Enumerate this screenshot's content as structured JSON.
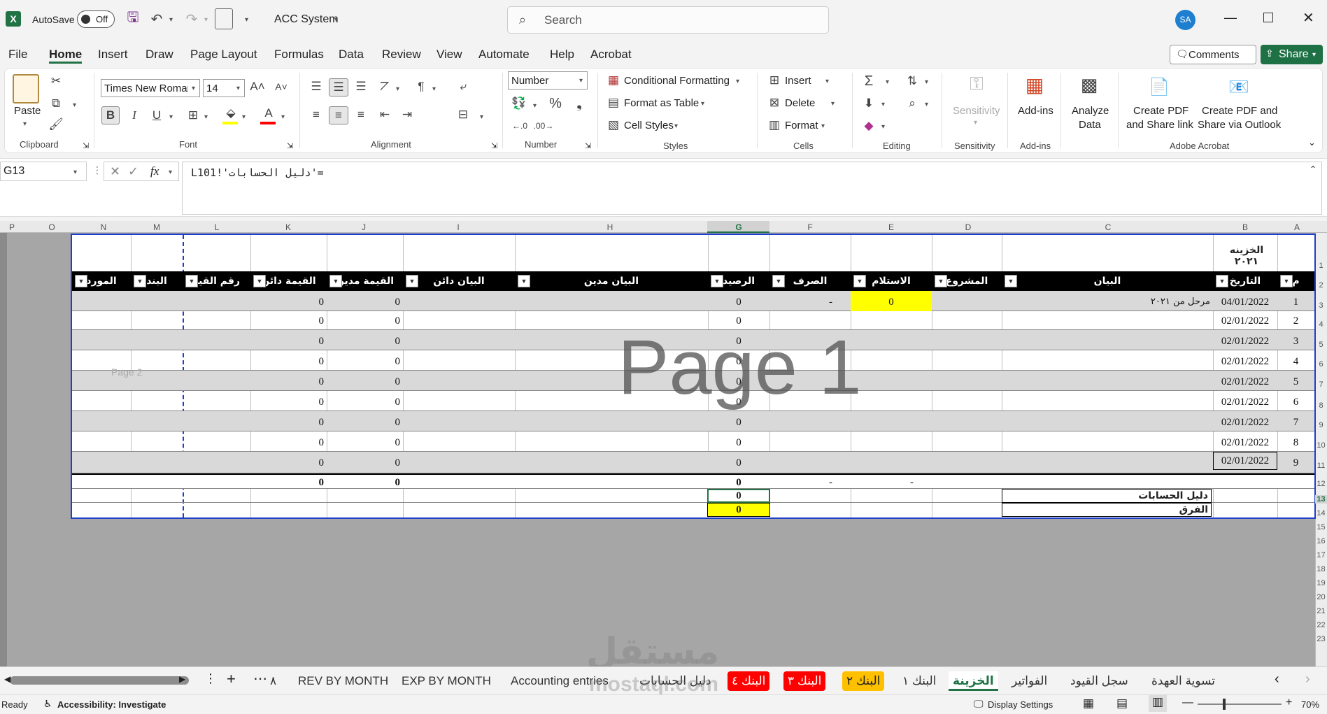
{
  "app": {
    "autosave_label": "AutoSave",
    "autosave_state": "Off",
    "file_name": "ACC System",
    "search_placeholder": "Search",
    "user_initials": "SA"
  },
  "colors": {
    "excel_green": "#217346",
    "header_black": "#000000",
    "highlight_yellow": "#ffff00",
    "tab_red": "#ff0000",
    "tab_orange": "#ffc000",
    "selection_blue": "#1f3ec9"
  },
  "menu": [
    "File",
    "Home",
    "Insert",
    "Draw",
    "Page Layout",
    "Formulas",
    "Data",
    "Review",
    "View",
    "Automate",
    "Help",
    "Acrobat"
  ],
  "menu_active": "Home",
  "top_buttons": {
    "comments": "Comments",
    "share": "Share"
  },
  "ribbon": {
    "clipboard": {
      "paste": "Paste",
      "label": "Clipboard"
    },
    "font": {
      "name": "Times New Roman",
      "size": "14",
      "label": "Font"
    },
    "alignment": {
      "label": "Alignment"
    },
    "number": {
      "format": "Number",
      "label": "Number"
    },
    "styles": {
      "conditional": "Conditional Formatting",
      "format_table": "Format as Table",
      "cell_styles": "Cell Styles",
      "label": "Styles"
    },
    "cells": {
      "insert": "Insert",
      "delete": "Delete",
      "format": "Format",
      "label": "Cells"
    },
    "editing": {
      "label": "Editing"
    },
    "sensitivity": {
      "btn": "Sensitivity",
      "label": "Sensitivity"
    },
    "addins": {
      "btn": "Add-ins",
      "label": "Add-ins"
    },
    "analyze": {
      "line1": "Analyze",
      "line2": "Data"
    },
    "acrobat": {
      "pdf1a": "Create PDF",
      "pdf1b": "and Share link",
      "pdf2a": "Create PDF and",
      "pdf2b": "Share via Outlook",
      "label": "Adobe Acrobat"
    }
  },
  "formula_bar": {
    "name_box": "G13",
    "formula": "='دليل الحسابات'!L101"
  },
  "columns": [
    "P",
    "O",
    "N",
    "M",
    "L",
    "K",
    "J",
    "I",
    "H",
    "G",
    "F",
    "E",
    "D",
    "C",
    "B",
    "A"
  ],
  "sheet": {
    "title": "الخزينه ٢٠٢١",
    "watermark": "Page 1",
    "page2": "Page 2",
    "headers": {
      "m": "م",
      "date": "التاريخ",
      "desc": "البيان",
      "project": "المشروع",
      "receipt": "الاستلام",
      "expense": "الصرف",
      "balance": "الرصيد",
      "debit_desc": "البيان مدين",
      "credit_desc": "البيان دائن",
      "debit_val": "القيمة مدين",
      "credit_val": "القيمة دائن",
      "entry_no": "رقم القيد",
      "item": "البند",
      "supplier": "المورد"
    },
    "rows": [
      {
        "m": "1",
        "date": "04/01/2022",
        "desc": "مرحل من ٢٠٢١",
        "receipt": "0",
        "expense": "-",
        "balance": "0",
        "debit": "0",
        "credit": "0"
      },
      {
        "m": "2",
        "date": "02/01/2022",
        "desc": "",
        "receipt": "",
        "expense": "",
        "balance": "0",
        "debit": "0",
        "credit": "0"
      },
      {
        "m": "3",
        "date": "02/01/2022",
        "desc": "",
        "receipt": "",
        "expense": "",
        "balance": "0",
        "debit": "0",
        "credit": "0"
      },
      {
        "m": "4",
        "date": "02/01/2022",
        "desc": "",
        "receipt": "",
        "expense": "",
        "balance": "0",
        "debit": "0",
        "credit": "0"
      },
      {
        "m": "5",
        "date": "02/01/2022",
        "desc": "",
        "receipt": "",
        "expense": "",
        "balance": "0",
        "debit": "0",
        "credit": "0"
      },
      {
        "m": "6",
        "date": "02/01/2022",
        "desc": "",
        "receipt": "",
        "expense": "",
        "balance": "0",
        "debit": "0",
        "credit": "0"
      },
      {
        "m": "7",
        "date": "02/01/2022",
        "desc": "",
        "receipt": "",
        "expense": "",
        "balance": "0",
        "debit": "0",
        "credit": "0"
      },
      {
        "m": "8",
        "date": "02/01/2022",
        "desc": "",
        "receipt": "",
        "expense": "",
        "balance": "0",
        "debit": "0",
        "credit": "0"
      },
      {
        "m": "9",
        "date": "02/01/2022",
        "desc": "",
        "receipt": "",
        "expense": "",
        "balance": "0",
        "debit": "0",
        "credit": "0"
      }
    ],
    "totals": {
      "receipt": "-",
      "expense": "-",
      "balance": "0",
      "debit": "0",
      "credit": "0"
    },
    "chart_of_accounts": {
      "label": "دليل الحسابات",
      "value": "0"
    },
    "difference": {
      "label": "الفرق",
      "value": "0"
    }
  },
  "row_numbers": [
    "1",
    "2",
    "3",
    "4",
    "5",
    "6",
    "7",
    "8",
    "9",
    "10",
    "11",
    "12",
    "13",
    "14",
    "15",
    "16",
    "17",
    "18",
    "19",
    "20",
    "21",
    "22",
    "23"
  ],
  "sheet_tabs": [
    {
      "name": "٨",
      "style": "plain"
    },
    {
      "name": "REV BY MONTH",
      "style": "plain"
    },
    {
      "name": "EXP BY MONTH",
      "style": "plain"
    },
    {
      "name": "Accounting entries",
      "style": "plain"
    },
    {
      "name": "دليل الحسابات",
      "style": "plain"
    },
    {
      "name": "البنك ٤",
      "style": "red"
    },
    {
      "name": "البنك ٣",
      "style": "red"
    },
    {
      "name": "البنك ٢",
      "style": "orange"
    },
    {
      "name": "البنك ١",
      "style": "plain"
    },
    {
      "name": "الخزينة",
      "style": "active"
    },
    {
      "name": "الفواتير",
      "style": "plain"
    },
    {
      "name": "سجل القيود",
      "style": "plain"
    },
    {
      "name": "تسوية العهدة",
      "style": "plain"
    }
  ],
  "status": {
    "ready": "Ready",
    "accessibility": "Accessibility: Investigate",
    "display": "Display Settings",
    "zoom": "70%"
  },
  "watermark_site": {
    "ar": "مستقل",
    "en": "mostaql.com"
  }
}
